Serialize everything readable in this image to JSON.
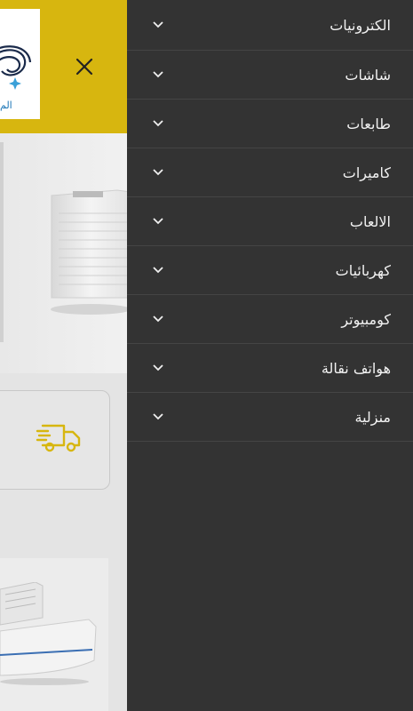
{
  "logo": {
    "text": "الم"
  },
  "menu": {
    "items": [
      {
        "label": "الكترونيات"
      },
      {
        "label": "شاشات"
      },
      {
        "label": "طابعات"
      },
      {
        "label": "كاميرات"
      },
      {
        "label": "الالعاب"
      },
      {
        "label": "كهربائيات"
      },
      {
        "label": "كومبيوتر"
      },
      {
        "label": "هواتف نقالة"
      },
      {
        "label": "منزلية"
      }
    ]
  },
  "colors": {
    "accent": "#d7b60f",
    "drawer": "#333333",
    "logo_blue": "#1b75b6"
  },
  "icons": {
    "close": "close-icon",
    "chevron": "chevron-down-icon",
    "truck": "delivery-truck-icon"
  }
}
